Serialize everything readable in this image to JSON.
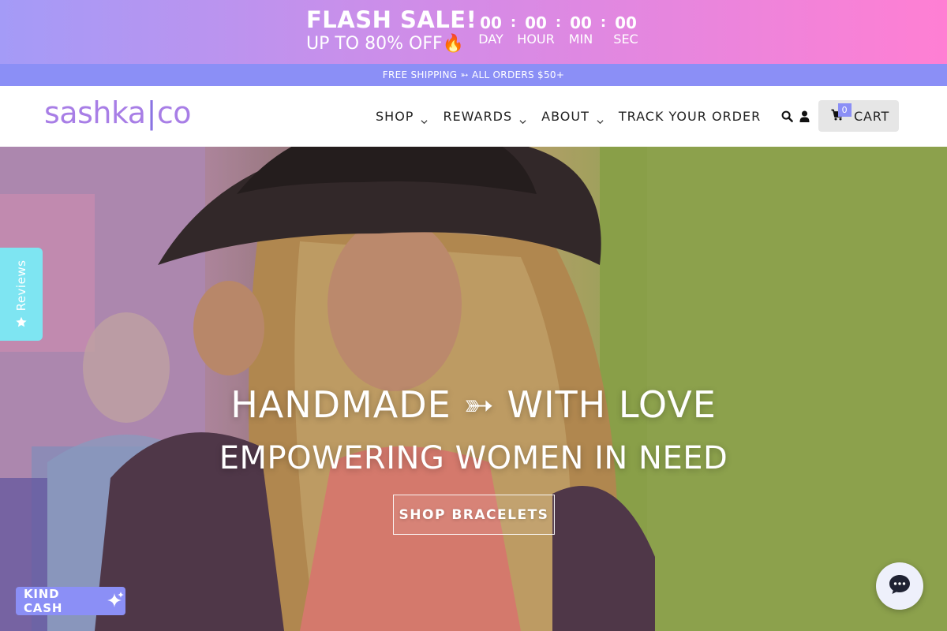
{
  "flash_sale": {
    "title": "FLASH SALE!",
    "subtitle": "UP TO 80% OFF🔥",
    "countdown": [
      {
        "value": "00",
        "label": "DAY"
      },
      {
        "value": "00",
        "label": "HOUR"
      },
      {
        "value": "00",
        "label": "MIN"
      },
      {
        "value": "00",
        "label": "SEC"
      }
    ],
    "separator": ":"
  },
  "shipping_bar": {
    "text": "FREE SHIPPING ➳ ALL ORDERS $50+"
  },
  "header": {
    "logo": {
      "left": "sashka",
      "bar": "|",
      "right": "co"
    },
    "nav": [
      {
        "label": "SHOP",
        "has_dropdown": true
      },
      {
        "label": "REWARDS",
        "has_dropdown": true
      },
      {
        "label": "ABOUT",
        "has_dropdown": true
      },
      {
        "label": "TRACK YOUR ORDER",
        "has_dropdown": false
      }
    ],
    "icons": [
      "search-icon",
      "user-icon"
    ],
    "cart": {
      "label": "CART",
      "count": "0"
    }
  },
  "hero": {
    "line1": "HANDMADE ➳ WITH LOVE",
    "line2": "EMPOWERING WOMEN IN NEED",
    "cta": "SHOP BRACELETS"
  },
  "reviews_tab": {
    "label": "Reviews"
  },
  "kind_cash": {
    "label": "KIND CASH"
  },
  "colors": {
    "accent": "#8b8ff6",
    "logo": "#a87ee6",
    "reviews_tab": "#7ee5f2",
    "banner_left": "#a49bf7",
    "banner_right": "#ff7fd3"
  }
}
